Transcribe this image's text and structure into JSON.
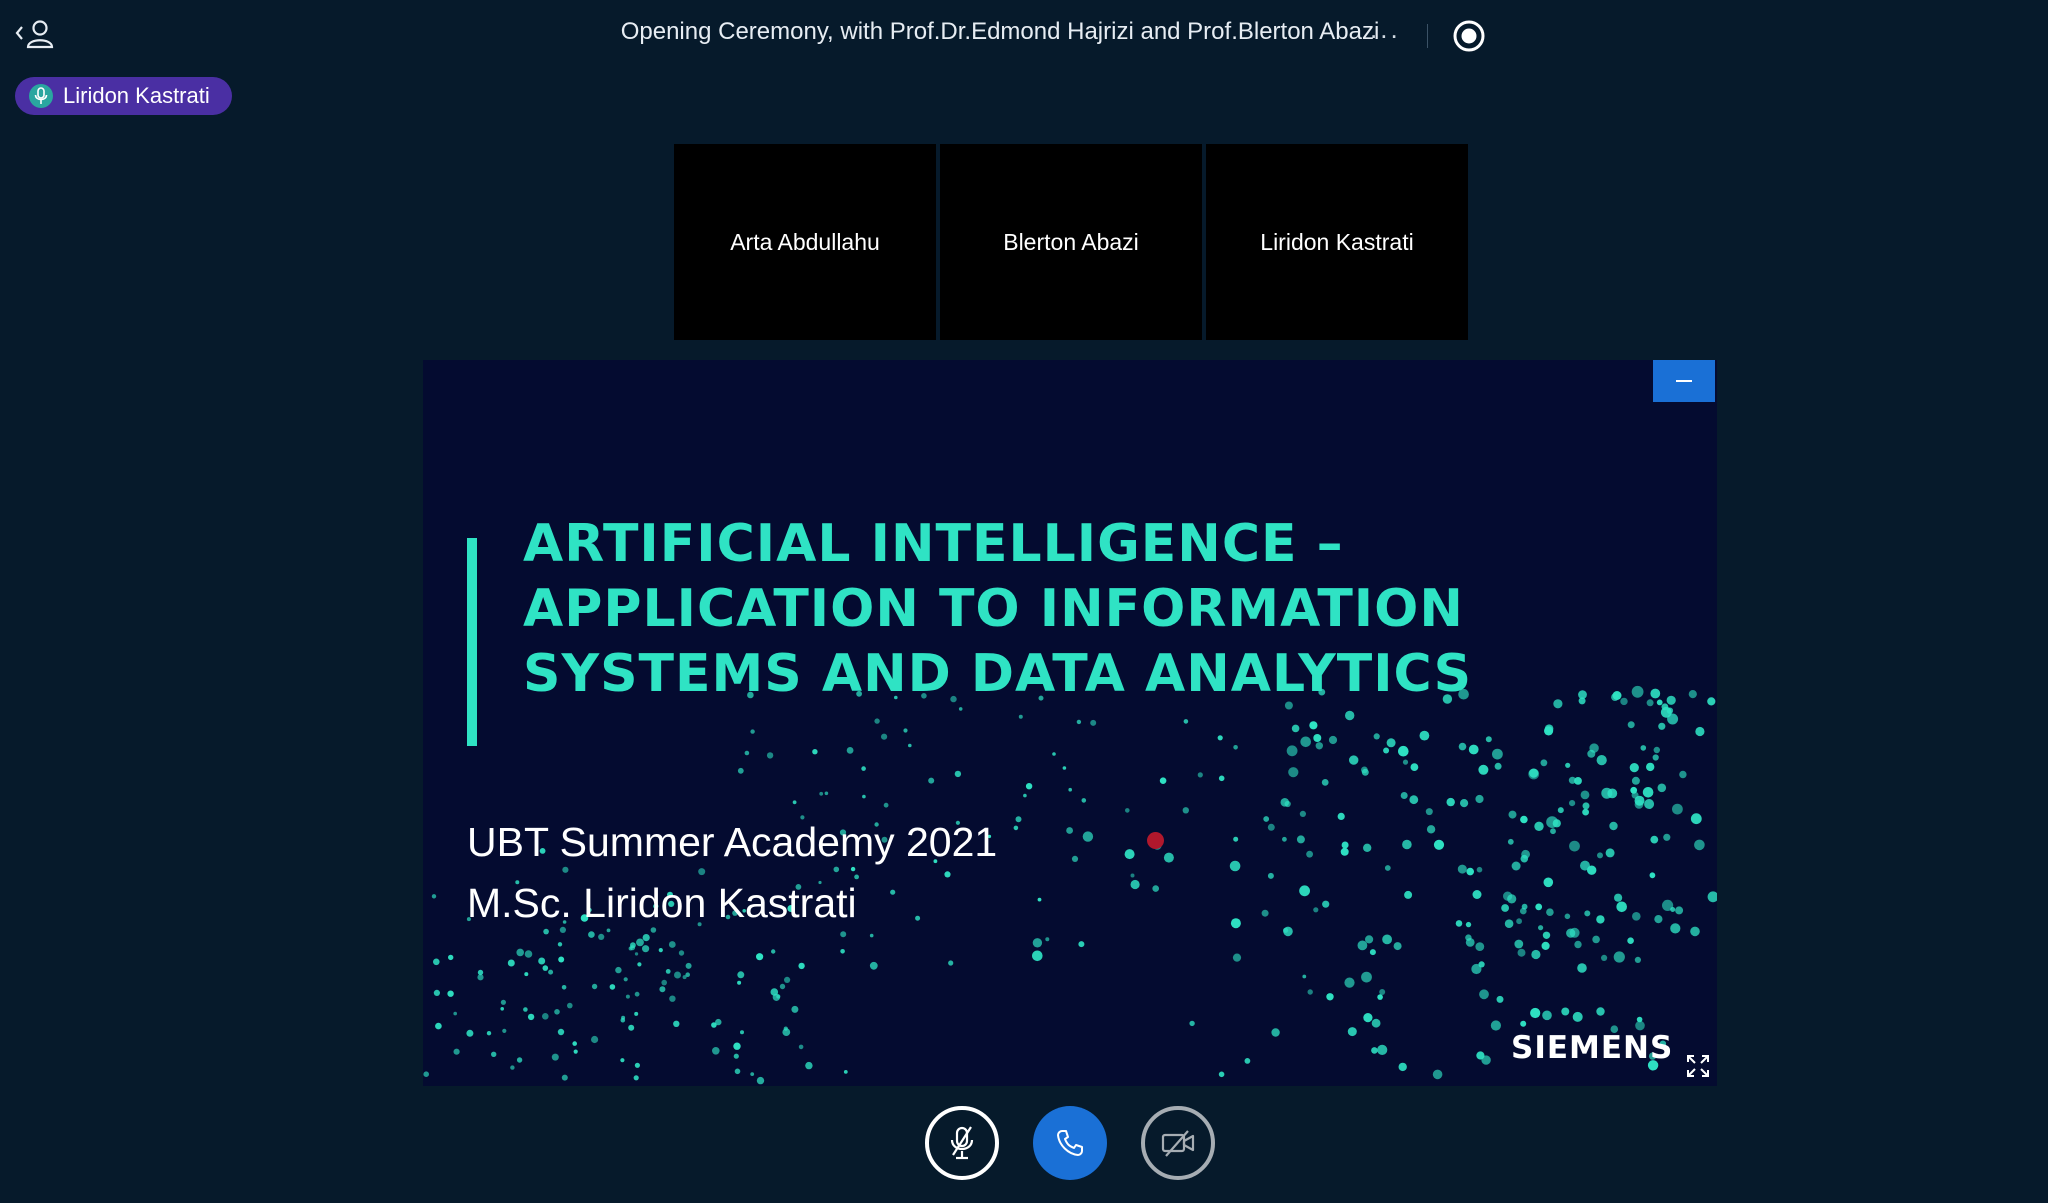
{
  "window": {
    "title": "Opening Ceremony, with Prof.Dr.Edmond Hajrizi and Prof.Blerton Abazi",
    "more_label": "..."
  },
  "talking_indicator": {
    "name": "Liridon Kastrati"
  },
  "video_tiles": [
    {
      "name": "Arta Abdullahu"
    },
    {
      "name": "Blerton Abazi"
    },
    {
      "name": "Liridon Kastrati"
    }
  ],
  "presentation": {
    "title_lines": [
      "ARTIFICIAL INTELLIGENCE –",
      "APPLICATION TO INFORMATION",
      "SYSTEMS AND DATA ANALYTICS"
    ],
    "subtitle_lines": [
      "UBT Summer Academy 2021",
      "M.Sc. Liridon Kastrati"
    ],
    "logo_text": "SIEMENS",
    "accent_color": "#2fe3c4",
    "background_color": "#040b30"
  },
  "icons": {
    "user_list": "user-list-icon",
    "record": "record-icon",
    "microphone": "microphone-icon",
    "minimize": "minimize-icon",
    "fullscreen": "fullscreen-icon",
    "mute": "mic-muted-icon",
    "hangup": "phone-icon",
    "video": "video-off-icon"
  },
  "colors": {
    "app_background": "#061a2b",
    "primary_blue": "#1a70d6",
    "talker_purple": "#4a2fa3"
  }
}
